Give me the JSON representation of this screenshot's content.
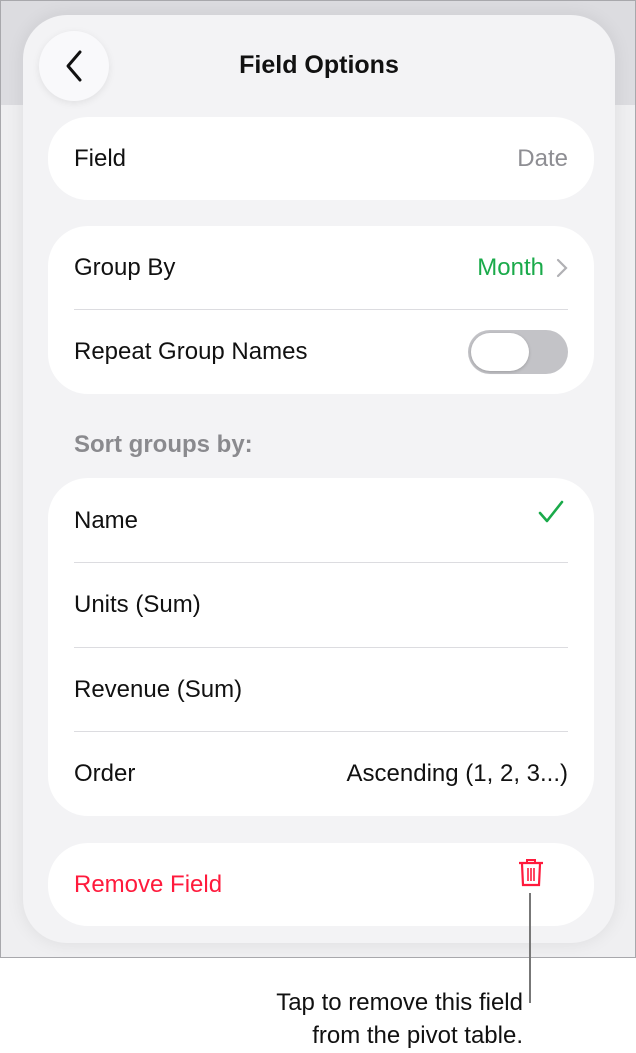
{
  "header": {
    "title": "Field Options",
    "back_icon": "chevron-left-icon"
  },
  "field_row": {
    "label": "Field",
    "value": "Date"
  },
  "group": {
    "group_by_label": "Group By",
    "group_by_value": "Month",
    "repeat_label": "Repeat Group Names",
    "repeat_on": false
  },
  "sort": {
    "section_label": "Sort groups by:",
    "options": [
      {
        "label": "Name",
        "checked": true
      },
      {
        "label": "Units (Sum)"
      },
      {
        "label": "Revenue (Sum)"
      }
    ],
    "order_label": "Order",
    "order_value": "Ascending (1, 2, 3...)"
  },
  "remove": {
    "label": "Remove Field"
  },
  "callout": {
    "line1": "Tap to remove this field",
    "line2": "from the pivot table."
  },
  "colors": {
    "accent_green": "#1aaa4a",
    "destructive_red": "#ff1a3c"
  }
}
